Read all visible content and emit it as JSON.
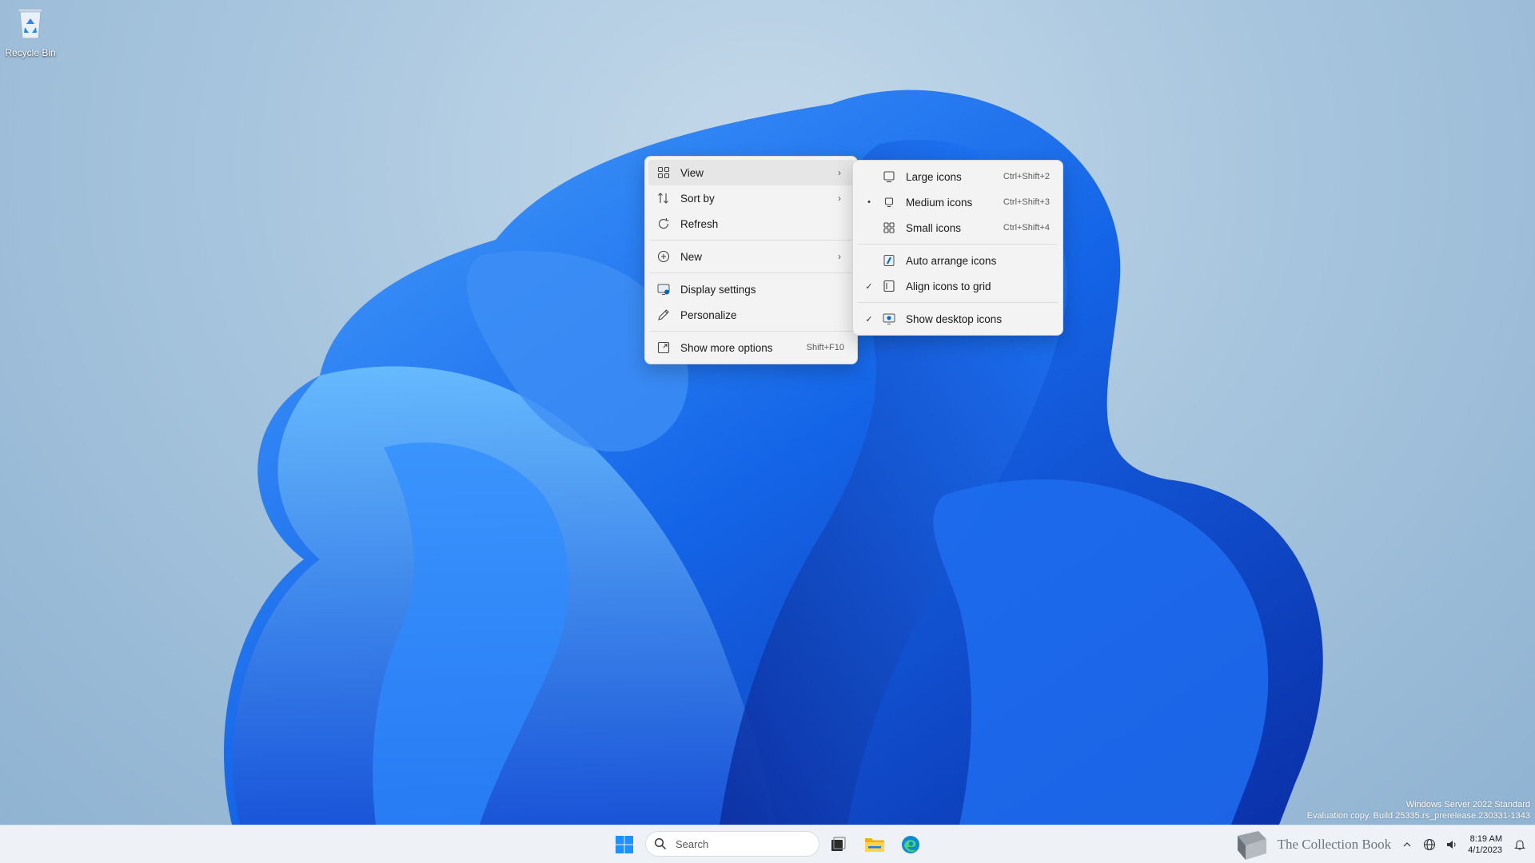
{
  "desktop": {
    "icons": [
      {
        "label": "Recycle Bin",
        "icon": "recycle-bin-icon"
      }
    ],
    "watermark": {
      "line1": "Windows Server 2022 Standard",
      "line2": "Evaluation copy. Build 25335.rs_prerelease.230331-1343"
    }
  },
  "context_menu": {
    "items": [
      {
        "label": "View",
        "icon": "view-grid-icon",
        "has_submenu": true
      },
      {
        "label": "Sort by",
        "icon": "sort-icon",
        "has_submenu": true
      },
      {
        "label": "Refresh",
        "icon": "refresh-icon"
      },
      {
        "label": "New",
        "icon": "new-plus-icon",
        "has_submenu": true
      },
      {
        "label": "Display settings",
        "icon": "display-icon"
      },
      {
        "label": "Personalize",
        "icon": "pen-icon"
      },
      {
        "label": "Show more options",
        "icon": "more-options-icon",
        "shortcut": "Shift+F10"
      }
    ]
  },
  "view_submenu": {
    "items": [
      {
        "label": "Large icons",
        "icon": "large-icons-icon",
        "shortcut": "Ctrl+Shift+2",
        "mark": ""
      },
      {
        "label": "Medium icons",
        "icon": "medium-icons-icon",
        "shortcut": "Ctrl+Shift+3",
        "mark": "•"
      },
      {
        "label": "Small icons",
        "icon": "small-icons-icon",
        "shortcut": "Ctrl+Shift+4",
        "mark": ""
      },
      {
        "label": "Auto arrange icons",
        "icon": "auto-arrange-icon",
        "mark": ""
      },
      {
        "label": "Align icons to grid",
        "icon": "align-grid-icon",
        "mark": "✓"
      },
      {
        "label": "Show desktop icons",
        "icon": "show-desktop-icon",
        "mark": "✓"
      }
    ]
  },
  "taskbar": {
    "search_placeholder": "Search",
    "tray_logo_text": "The Collection Book",
    "clock_time": "8:19 AM",
    "clock_date": "4/1/2023"
  },
  "colors": {
    "accent": "#0067c0",
    "menu_bg": "#f3f3f3",
    "taskbar_bg": "#eef2f7"
  }
}
